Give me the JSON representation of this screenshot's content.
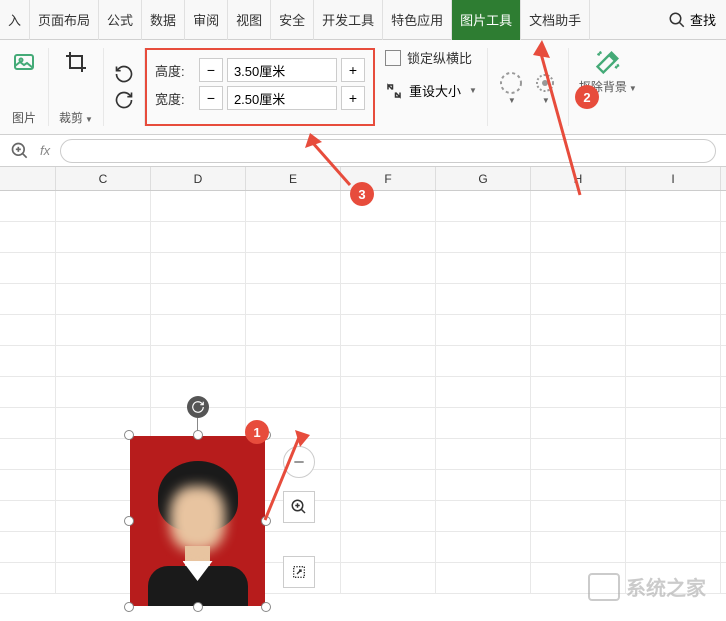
{
  "menu": {
    "tabs": [
      "入",
      "页面布局",
      "公式",
      "数据",
      "审阅",
      "视图",
      "安全",
      "开发工具",
      "特色应用",
      "图片工具",
      "文档助手"
    ],
    "active_index": 9,
    "search_label": "查找"
  },
  "ribbon": {
    "pic_label": "图片",
    "crop_label": "裁剪",
    "height_label": "高度:",
    "height_value": "3.50厘米",
    "width_label": "宽度:",
    "width_value": "2.50厘米",
    "lock_label": "锁定纵横比",
    "reset_label": "重设大小",
    "bgremove_label": "抠除背景",
    "minus": "−",
    "plus": "+"
  },
  "columns": [
    "",
    "C",
    "D",
    "E",
    "F",
    "G",
    "H",
    "I"
  ],
  "formula": {
    "fx": "fx"
  },
  "annotations": {
    "n1": "1",
    "n2": "2",
    "n3": "3"
  },
  "watermark": {
    "text": "系统之家"
  }
}
